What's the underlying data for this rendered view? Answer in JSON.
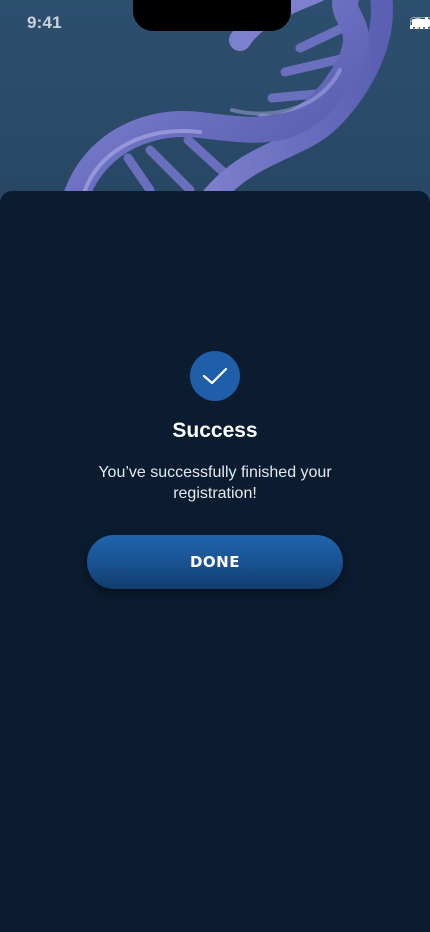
{
  "status_bar": {
    "time": "9:41",
    "icons": [
      "signal-icon",
      "wifi-icon",
      "battery-icon"
    ]
  },
  "hero": {
    "image": "dna-helix-image"
  },
  "dialog": {
    "icon": "checkmark-icon",
    "title": "Success",
    "message": "You’ve successfully finished your registration!",
    "done_label": "DONE"
  },
  "colors": {
    "background": "#0b1c30",
    "accent": "#1f5ea8",
    "hero_top": "#2d4f6e"
  }
}
